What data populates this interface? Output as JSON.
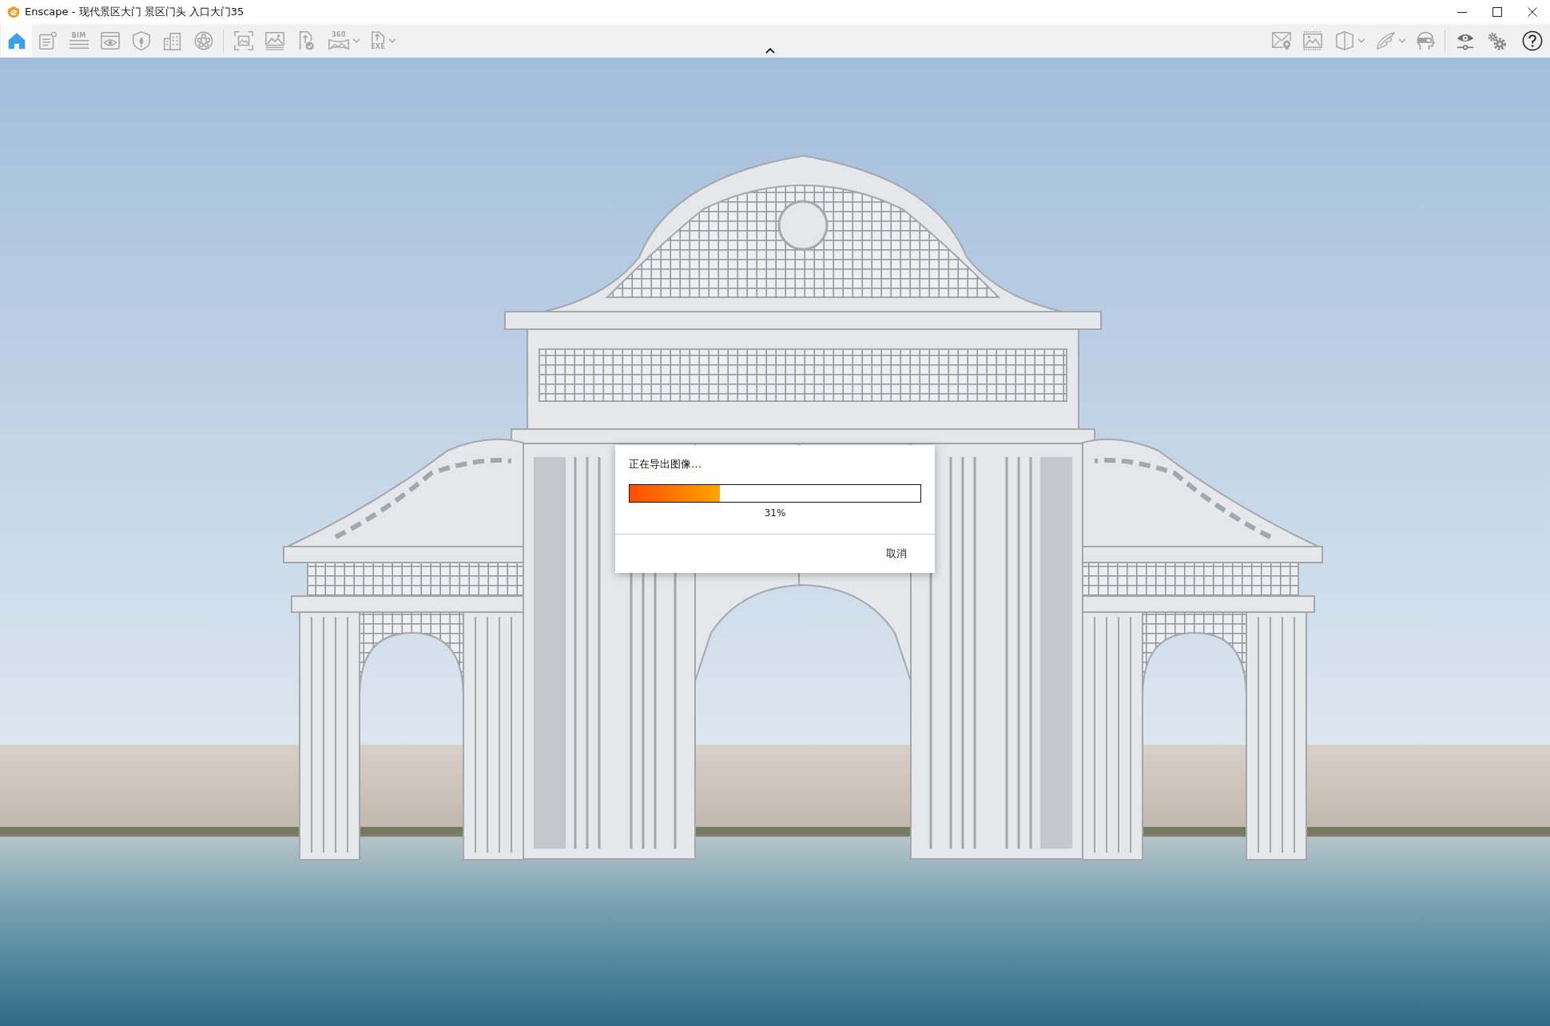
{
  "window": {
    "title": "Enscape - 现代景区大门 景区门头 入口大门35"
  },
  "toolbar": {
    "left_groups": [
      {
        "tools": [
          {
            "selected": true,
            "dropdown": false
          },
          {
            "selected": false,
            "dropdown": false
          },
          {
            "label": "BIM",
            "selected": false,
            "dropdown": false
          },
          {
            "selected": false,
            "dropdown": false
          },
          {
            "selected": false,
            "dropdown": false
          },
          {
            "selected": false,
            "dropdown": false
          },
          {
            "selected": false,
            "dropdown": false
          }
        ]
      },
      {
        "tools": [
          {
            "selected": false,
            "dropdown": false
          },
          {
            "selected": false,
            "dropdown": false
          },
          {
            "selected": false,
            "dropdown": false
          },
          {
            "label": "360",
            "selected": false,
            "dropdown": true
          },
          {
            "label": "EXE",
            "selected": false,
            "dropdown": true
          }
        ]
      }
    ],
    "right_groups": [
      {
        "tools": [
          {
            "dropdown": false
          },
          {
            "dropdown": false
          },
          {
            "dropdown": true
          },
          {
            "dropdown": true
          },
          {
            "dropdown": false
          }
        ]
      },
      {
        "tools": [
          {
            "dropdown": false
          },
          {
            "dropdown": false
          },
          {
            "dropdown": false
          }
        ]
      }
    ]
  },
  "dialog": {
    "message": "正在导出图像…",
    "progress": {
      "level": 0.31,
      "reading": "31%"
    },
    "buttons": [
      "取消"
    ]
  }
}
